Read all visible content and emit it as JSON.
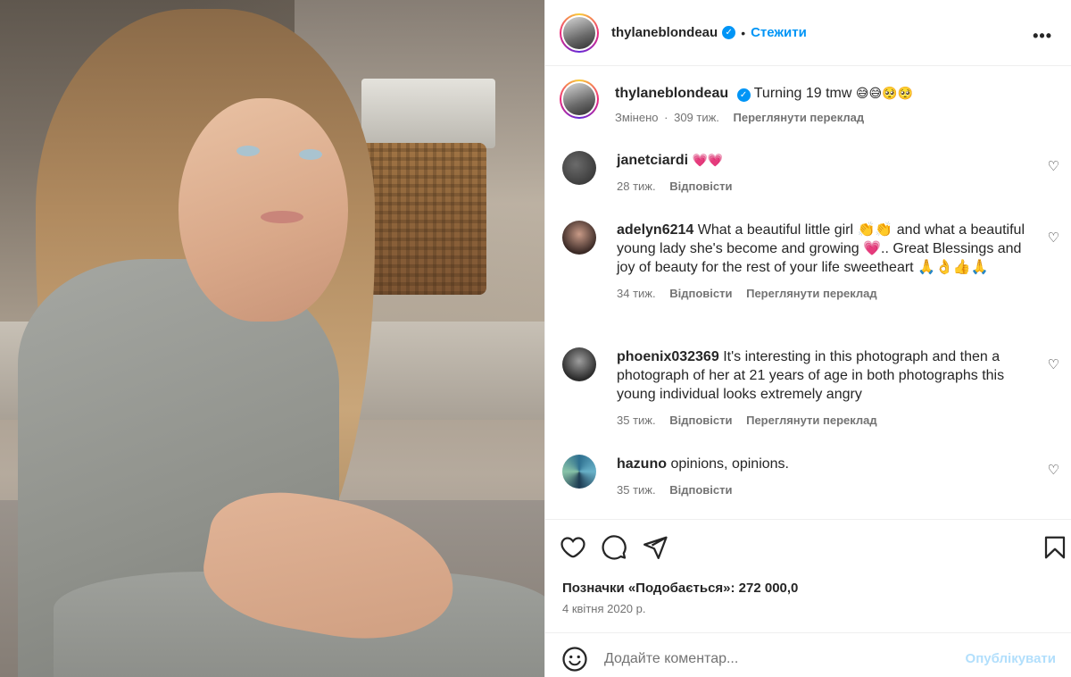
{
  "header": {
    "username": "thylaneblondeau",
    "verified_badge": "✓",
    "separator": "•",
    "follow_label": "Стежити",
    "more_label": "•••"
  },
  "caption": {
    "username": "thylaneblondeau",
    "text": "Turning 19 tmw",
    "emojis": "😅😅🥺🥺",
    "edited": "Змінено",
    "dot": "·",
    "age": "309 тиж.",
    "translate": "Переглянути переклад"
  },
  "comments": [
    {
      "username": "janetciardi",
      "text": "💗💗",
      "age": "28 тиж.",
      "reply": "Відповісти",
      "translate": ""
    },
    {
      "username": "adelyn6214",
      "text": "What a beautiful little girl 👏👏 and what a beautiful young lady she's become and growing 💗.. Great Blessings and joy of beauty for the rest of your life sweetheart 🙏👌👍🙏",
      "age": "34 тиж.",
      "reply": "Відповісти",
      "translate": "Переглянути переклад"
    },
    {
      "username": "phoenix032369",
      "text": "It's interesting in this photograph and then a photograph of her at 21 years of age in both photographs this young individual looks extremely angry",
      "age": "35 тиж.",
      "reply": "Відповісти",
      "translate": "Переглянути переклад"
    },
    {
      "username": "hazuno",
      "text": "opinions, opinions.",
      "age": "35 тиж.",
      "reply": "Відповісти",
      "translate": ""
    }
  ],
  "actions": {
    "like_icon": "heart-icon",
    "comment_icon": "comment-icon",
    "share_icon": "share-icon",
    "save_icon": "bookmark-icon"
  },
  "likes_text": "Позначки «Подобається»: 272 000,0",
  "date_text": "4 квітня 2020 р.",
  "add_comment": {
    "placeholder": "Додайте коментар...",
    "post_label": "Опублікувати"
  },
  "colors": {
    "accent": "#0095f6",
    "post_disabled": "#b2dffc",
    "heart_red": "#ed4956",
    "text": "#262626",
    "muted": "#737373"
  }
}
